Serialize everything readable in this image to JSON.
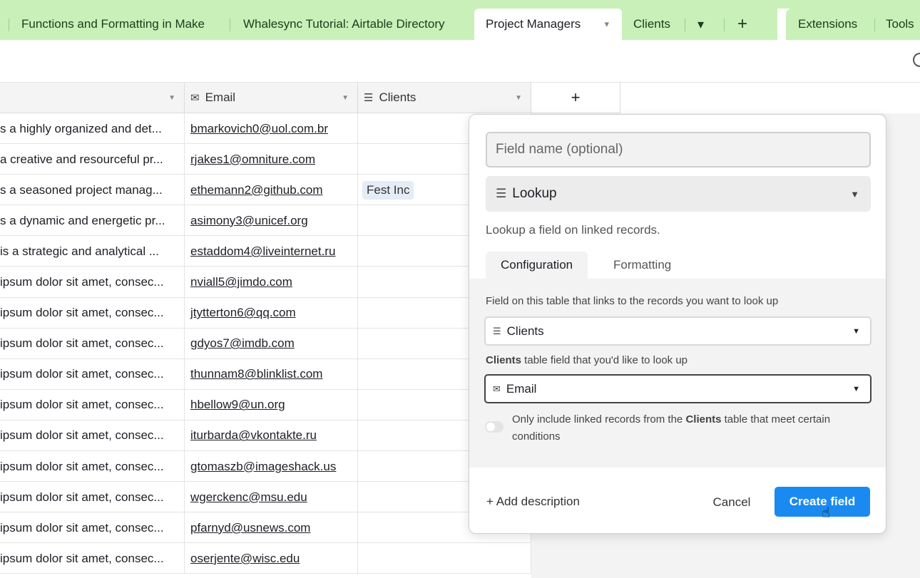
{
  "tabs": [
    {
      "label": "Functions and Formatting in Make"
    },
    {
      "label": "Whalesync Tutorial: Airtable Directory"
    },
    {
      "label": "Project Managers"
    },
    {
      "label": "Clients"
    }
  ],
  "tab_extras": {
    "chevron": "▾",
    "plus": "+",
    "extensions": "Extensions",
    "tools": "Tools"
  },
  "grid": {
    "headers": {
      "email": "Email",
      "clients": "Clients",
      "add": "+"
    },
    "rows": [
      {
        "text": "s a highly organized and det...",
        "email": "bmarkovich0@uol.com.br",
        "client": ""
      },
      {
        "text": "a creative and resourceful pr...",
        "email": "rjakes1@omniture.com",
        "client": ""
      },
      {
        "text": "s a seasoned project manag...",
        "email": "ethemann2@github.com",
        "client": "Fest Inc"
      },
      {
        "text": "s a dynamic and energetic pr...",
        "email": "asimony3@unicef.org",
        "client": ""
      },
      {
        "text": " is a strategic and analytical ...",
        "email": "estaddom4@liveinternet.ru",
        "client": ""
      },
      {
        "text": "ipsum dolor sit amet, consec...",
        "email": "nviall5@jimdo.com",
        "client": ""
      },
      {
        "text": "ipsum dolor sit amet, consec...",
        "email": "jtytterton6@qq.com",
        "client": ""
      },
      {
        "text": "ipsum dolor sit amet, consec...",
        "email": "gdyos7@imdb.com",
        "client": ""
      },
      {
        "text": "ipsum dolor sit amet, consec...",
        "email": "thunnam8@blinklist.com",
        "client": ""
      },
      {
        "text": "ipsum dolor sit amet, consec...",
        "email": "hbellow9@un.org",
        "client": ""
      },
      {
        "text": "ipsum dolor sit amet, consec...",
        "email": "iturbarda@vkontakte.ru",
        "client": ""
      },
      {
        "text": "ipsum dolor sit amet, consec...",
        "email": "gtomaszb@imageshack.us",
        "client": ""
      },
      {
        "text": "ipsum dolor sit amet, consec...",
        "email": "wgerckenc@msu.edu",
        "client": ""
      },
      {
        "text": "ipsum dolor sit amet, consec...",
        "email": "pfarnyd@usnews.com",
        "client": ""
      },
      {
        "text": "ipsum dolor sit amet, consec...",
        "email": "oserjente@wisc.edu",
        "client": ""
      }
    ]
  },
  "panel": {
    "field_name_placeholder": "Field name (optional)",
    "field_type": "Lookup",
    "type_description": "Lookup a field on linked records.",
    "tab_configuration": "Configuration",
    "tab_formatting": "Formatting",
    "link_label": "Field on this table that links to the records you want to look up",
    "link_value": "Clients",
    "lookup_label_bold": "Clients",
    "lookup_label_rest": " table field that you'd like to look up",
    "lookup_value": "Email",
    "toggle_text_1": "Only include linked records from the ",
    "toggle_text_bold": "Clients",
    "toggle_text_2": " table that meet certain conditions",
    "add_description": "+ Add description",
    "cancel": "Cancel",
    "create": "Create field"
  },
  "colors": {
    "tab_bg": "#c8f0b8",
    "primary_button": "#1a8af0"
  }
}
